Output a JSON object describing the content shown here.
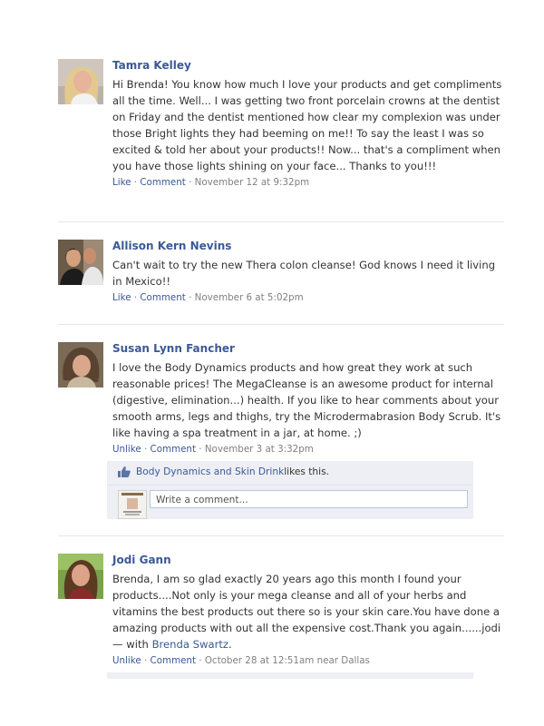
{
  "posts": [
    {
      "author": "Tamra Kelley",
      "text": "Hi Brenda! You know how much I love your products and get compliments all the time. Well... I was getting two front porcelain crowns at the dentist on Friday and the dentist mentioned how clear my complexion was under those Bright lights they had beeming on me!! To say the least I was so excited & told her about your products!! Now... that's a compliment when you have those lights shining on your face... Thanks to you!!!",
      "like": "Like",
      "comment": "Comment",
      "time": "November 12 at 9:32pm"
    },
    {
      "author": "Allison Kern Nevins",
      "text": "Can't wait to try the new Thera colon cleanse! God knows I need it living in Mexico!!",
      "like": "Like",
      "comment": "Comment",
      "time": "November 6 at 5:02pm"
    },
    {
      "author": "Susan Lynn Fancher",
      "text": "I love the Body Dynamics products and how great they work at such reasonable prices! The MegaCleanse is an awesome product for internal (digestive, elimination...) health. If you like to hear comments about your smooth arms, legs and thighs, try the Microdermabrasion Body Scrub. It's like having a spa treatment in a jar, at home. ;)",
      "like": "Unlike",
      "comment": "Comment",
      "time": "November 3 at 3:32pm",
      "likes_link": "Body Dynamics and Skin Drink",
      "likes_suffix": " likes this.",
      "comment_placeholder": "Write a comment..."
    },
    {
      "author": "Jodi Gann",
      "text": "Brenda, I am so glad exactly 20 years ago this month I found your products....Not only is your mega cleanse and all of your herbs and vitamins the best products out there so is your skin care.You have done a amazing products with out all the expensive cost.Thank you again......jodi",
      "with_prefix": " — with ",
      "with_name": "Brenda Swartz",
      "with_suffix": ".",
      "like": "Unlike",
      "comment": "Comment",
      "time": "October 28 at 12:51am near Dallas"
    }
  ],
  "separator": " · ",
  "colors": {
    "link": "#3b5998",
    "text": "#333333",
    "meta": "#808080",
    "panel": "#edeff4"
  }
}
